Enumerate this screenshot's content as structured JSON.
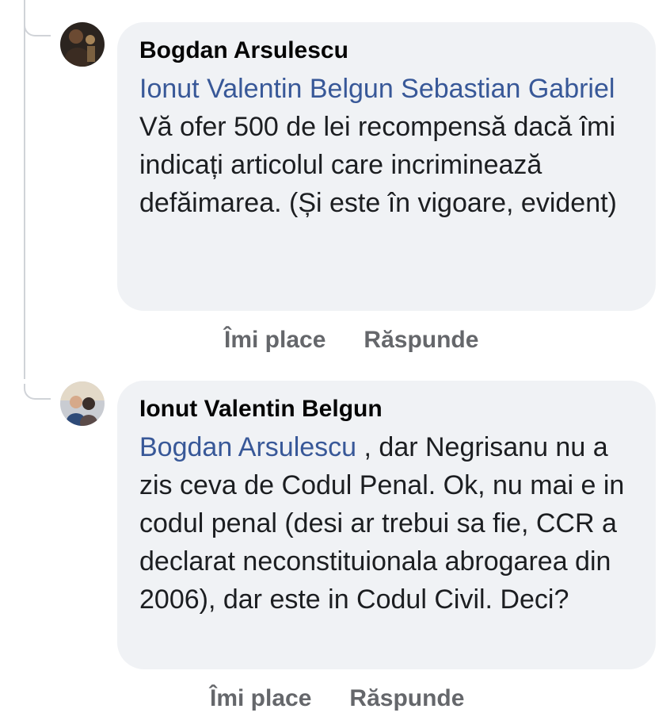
{
  "comments": [
    {
      "author": "Bogdan Arsulescu",
      "mention": "Ionut Valentin Belgun Sebastian Gabriel",
      "body": " Vă ofer 500 de lei recompensă dacă îmi indicați articolul care incriminează defăimarea. (Și este în vigoare, evident)",
      "like_label": "Îmi place",
      "reply_label": "Răspunde"
    },
    {
      "author": "Ionut Valentin Belgun",
      "mention": "Bogdan Arsulescu",
      "body": " , dar Negrisanu nu a zis ceva de Codul Penal. Ok, nu mai e in codul penal (desi ar trebui sa fie, CCR a declarat neconstituionala abrogarea din 2006), dar este in Codul Civil. Deci?",
      "like_label": "Îmi place",
      "reply_label": "Răspunde"
    }
  ],
  "colors": {
    "mention": "#385898",
    "bubble": "#f0f2f5",
    "action": "#65676b",
    "thread_line": "#d0d3d8"
  }
}
